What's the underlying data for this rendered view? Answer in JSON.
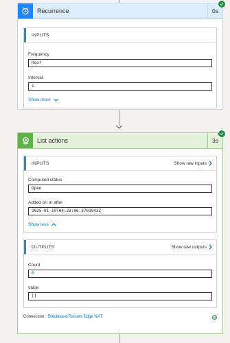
{
  "recurrence": {
    "title": "Recurrence",
    "duration": "0s",
    "inputs_header": "INPUTS",
    "frequency_label": "Frequency",
    "frequency_value": "Hour",
    "interval_label": "Interval",
    "interval_value": "1",
    "show_more": "Show more",
    "accent_color": "#1f85ff",
    "header_bg": "#dceefe"
  },
  "list_actions": {
    "title": "List actions",
    "duration": "3s",
    "header_bg": "#e4f1dd",
    "icon_bg": "#5eb547",
    "inputs": {
      "header": "INPUTS",
      "raw_link": "Show raw inputs",
      "computed_status_label": "Computed status",
      "computed_status_value": "Open",
      "added_label": "Added on or after",
      "added_value": "2025-01-19T04:23:06.3703943Z",
      "show_less": "Show less"
    },
    "outputs": {
      "header": "OUTPUTS",
      "raw_link": "Show raw outputs",
      "count_label": "Count",
      "count_value": "0",
      "value_label": "value",
      "value_value": "[]"
    },
    "connection_label": "Connection:",
    "connection_name": "Blackbaud Raisers Edge NXT"
  },
  "status_color": "#1e8e3e"
}
